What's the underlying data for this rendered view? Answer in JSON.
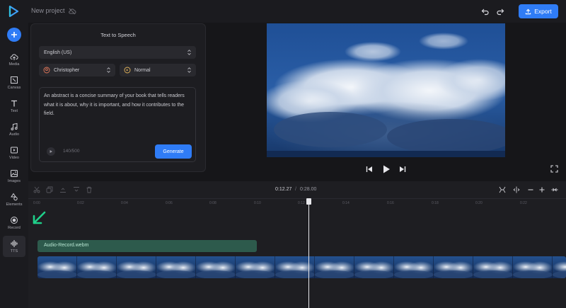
{
  "header": {
    "project_name": "New project",
    "export_label": "Export"
  },
  "sidebar": {
    "items": [
      {
        "label": "Media",
        "icon": "upload-cloud-icon"
      },
      {
        "label": "Canvas",
        "icon": "crop-icon"
      },
      {
        "label": "Text",
        "icon": "text-icon"
      },
      {
        "label": "Audio",
        "icon": "music-note-icon"
      },
      {
        "label": "Video",
        "icon": "video-icon"
      },
      {
        "label": "Images",
        "icon": "image-icon"
      },
      {
        "label": "Elements",
        "icon": "shapes-icon"
      },
      {
        "label": "Record",
        "icon": "record-icon"
      },
      {
        "label": "TTS",
        "icon": "waveform-icon"
      }
    ],
    "active": "TTS"
  },
  "tts": {
    "title": "Text to Speech",
    "language": "English (US)",
    "voice": "Christopher",
    "speed": "Normal",
    "text": "An abstract is a concise summary of your book that tells readers what it is about, why it is important, and how it contributes to the field.",
    "char_count": "140/500",
    "generate_label": "Generate"
  },
  "timeline": {
    "current_time": "0:12.27",
    "separator": "/",
    "total_time": "0:28.00",
    "ruler_ticks": [
      "0:00",
      "0:02",
      "0:04",
      "0:06",
      "0:08",
      "0:10",
      "0:12",
      "0:14",
      "0:16",
      "0:18",
      "0:20",
      "0:22"
    ],
    "audio_clip_name": "Audio-Record.webm",
    "playhead_progress": 0.438
  },
  "colors": {
    "accent": "#2f7cf6",
    "audio_clip": "#2d5a4c",
    "arrow": "#1fd08a"
  }
}
